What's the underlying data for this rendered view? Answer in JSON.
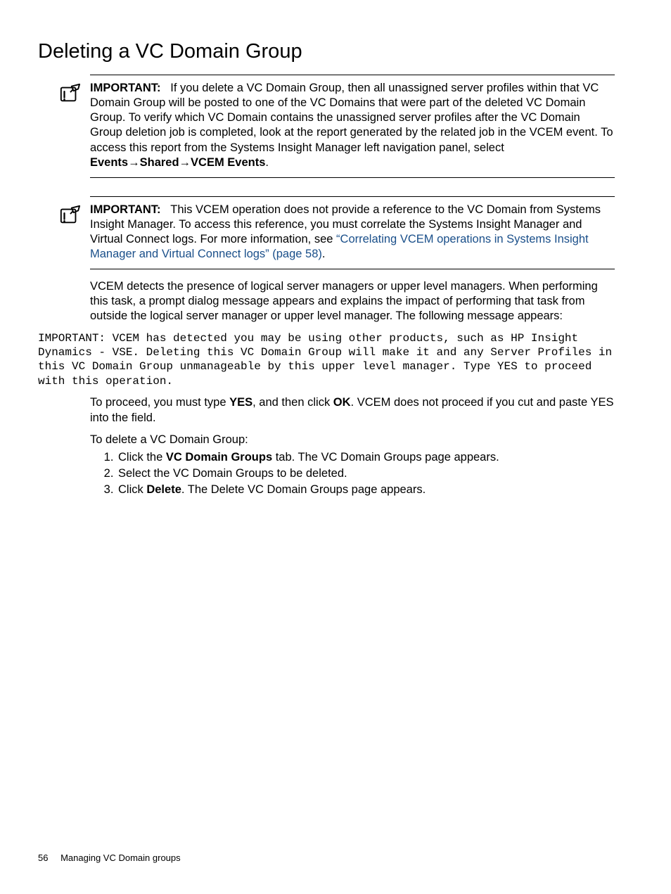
{
  "title": "Deleting a VC Domain Group",
  "callout1": {
    "label": "IMPORTANT:",
    "text_before": "If you delete a VC Domain Group, then all unassigned server profiles within that VC Domain Group will be posted to one of the VC Domains that were part of the deleted VC Domain Group. To verify which VC Domain contains the unassigned server profiles after the VC Domain Group deletion job is completed, look at the report generated by the related job in the VCEM event. To access this report from the Systems Insight Manager left navigation panel, select ",
    "bc1": "Events",
    "bc2": "Shared",
    "bc3": "VCEM Events",
    "period": "."
  },
  "callout2": {
    "label": "IMPORTANT:",
    "text_before": "This VCEM operation does not provide a reference to the VC Domain from Systems Insight Manager. To access this reference, you must correlate the Systems Insight Manager and Virtual Connect logs. For more information, see ",
    "link_text": "“Correlating VCEM operations in Systems Insight Manager and Virtual Connect logs” (page 58)",
    "after": "."
  },
  "para_detect": "VCEM detects the presence of logical server managers or upper level managers. When performing this task, a prompt dialog message appears and explains the impact of performing that task from outside the logical server manager or upper level manager. The following message appears:",
  "mono_msg": "IMPORTANT: VCEM has detected you may be using other products, such as HP Insight Dynamics - VSE. Deleting this VC Domain Group will make it and any Server Profiles in this VC Domain Group unmanageable by this upper level manager. Type YES to proceed with this operation.",
  "proceed": {
    "p1": "To proceed, you must type ",
    "b1": "YES",
    "p2": ", and then click ",
    "b2": "OK",
    "p3": ". VCEM does not proceed if you cut and paste YES into the field."
  },
  "to_delete": "To delete a VC Domain Group:",
  "steps": {
    "s1a": "Click the ",
    "s1b": "VC Domain Groups",
    "s1c": " tab. The VC Domain Groups page appears.",
    "s2": "Select the VC Domain Groups to be deleted.",
    "s3a": "Click ",
    "s3b": "Delete",
    "s3c": ". The Delete VC Domain Groups page appears."
  },
  "footer": {
    "page": "56",
    "section": "Managing VC Domain groups"
  }
}
